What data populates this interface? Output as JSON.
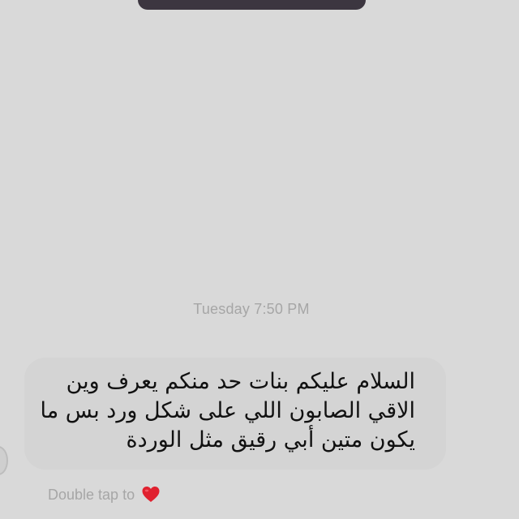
{
  "thread": {
    "timestamp": "Tuesday 7:50 PM"
  },
  "message": {
    "lines": [
      "السلام عليكم بنات حد منكم يعرف وين",
      "الاقي الصابون اللي على شكل ورد بس ما",
      "يكون متين أبي رقيق مثل  الوردة"
    ]
  },
  "reaction_hint": {
    "label": "Double tap to",
    "icon": "heart-icon",
    "icon_color": "#e0212f"
  },
  "colors": {
    "background": "#d9d9d9",
    "bubble": "#d4d4d4",
    "secondary_text": "#a6a6a6",
    "message_text": "#111111"
  }
}
